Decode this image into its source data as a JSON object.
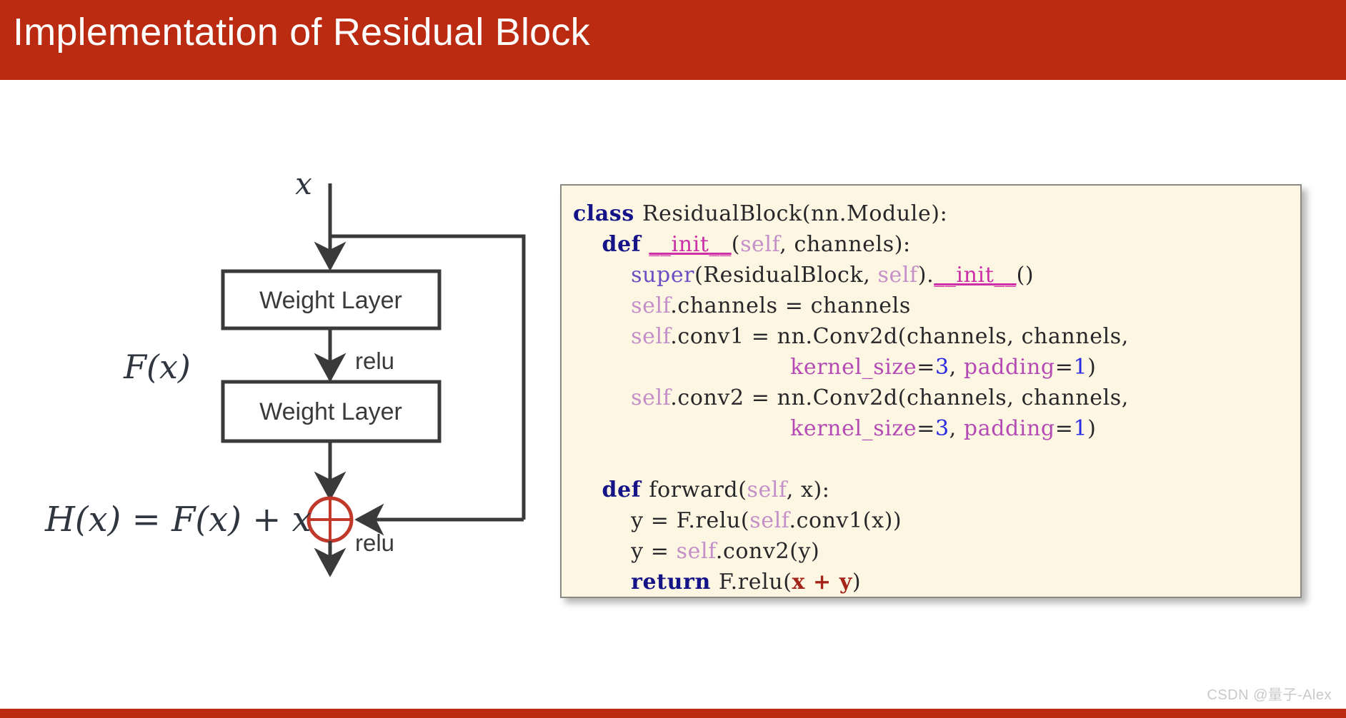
{
  "slide": {
    "title": "Implementation of Residual Block",
    "title_bar_color": "#bb2b11",
    "bottom_bar_color": "#bb2b11",
    "background_color": "#ffffff",
    "watermark": "CSDN @量子-Alex"
  },
  "diagram": {
    "name": "residual-block-diagram",
    "line_color": "#3a3a3a",
    "accent_color": "#c0392b",
    "input_label": "x",
    "residual_label": "F(x)",
    "output_formula": "H(x) = F(x) + x",
    "blocks": [
      {
        "label": "Weight Layer"
      },
      {
        "label": "Weight Layer"
      }
    ],
    "activation_labels": [
      {
        "label": "relu"
      },
      {
        "label": "relu"
      }
    ],
    "add_operator": "plus-circle"
  },
  "code": {
    "language": "python",
    "background_color": "#fdf6e3",
    "border_color": "#8a8a82",
    "lines": [
      {
        "tokens": [
          {
            "t": "class ",
            "c": "k"
          },
          {
            "t": "ResidualBlock(nn.Module):",
            "c": ""
          }
        ]
      },
      {
        "tokens": [
          {
            "t": "    ",
            "c": ""
          },
          {
            "t": "def ",
            "c": "k"
          },
          {
            "t": "__init__",
            "c": "dn"
          },
          {
            "t": "(",
            "c": ""
          },
          {
            "t": "self",
            "c": "sf"
          },
          {
            "t": ", channels):",
            "c": ""
          }
        ]
      },
      {
        "tokens": [
          {
            "t": "        ",
            "c": ""
          },
          {
            "t": "super",
            "c": "su"
          },
          {
            "t": "(ResidualBlock, ",
            "c": ""
          },
          {
            "t": "self",
            "c": "sf"
          },
          {
            "t": ").",
            "c": ""
          },
          {
            "t": "__init__",
            "c": "dn"
          },
          {
            "t": "()",
            "c": ""
          }
        ]
      },
      {
        "tokens": [
          {
            "t": "        ",
            "c": ""
          },
          {
            "t": "self",
            "c": "sf"
          },
          {
            "t": ".channels = channels",
            "c": ""
          }
        ]
      },
      {
        "tokens": [
          {
            "t": "        ",
            "c": ""
          },
          {
            "t": "self",
            "c": "sf"
          },
          {
            "t": ".conv1 = nn.Conv2d(channels, channels,",
            "c": ""
          }
        ]
      },
      {
        "tokens": [
          {
            "t": "                              ",
            "c": ""
          },
          {
            "t": "kernel_size",
            "c": "kw"
          },
          {
            "t": "=",
            "c": ""
          },
          {
            "t": "3",
            "c": "nm"
          },
          {
            "t": ", ",
            "c": ""
          },
          {
            "t": "padding",
            "c": "kw"
          },
          {
            "t": "=",
            "c": ""
          },
          {
            "t": "1",
            "c": "nm"
          },
          {
            "t": ")",
            "c": ""
          }
        ]
      },
      {
        "tokens": [
          {
            "t": "        ",
            "c": ""
          },
          {
            "t": "self",
            "c": "sf"
          },
          {
            "t": ".conv2 = nn.Conv2d(channels, channels,",
            "c": ""
          }
        ]
      },
      {
        "tokens": [
          {
            "t": "                              ",
            "c": ""
          },
          {
            "t": "kernel_size",
            "c": "kw"
          },
          {
            "t": "=",
            "c": ""
          },
          {
            "t": "3",
            "c": "nm"
          },
          {
            "t": ", ",
            "c": ""
          },
          {
            "t": "padding",
            "c": "kw"
          },
          {
            "t": "=",
            "c": ""
          },
          {
            "t": "1",
            "c": "nm"
          },
          {
            "t": ")",
            "c": ""
          }
        ]
      },
      {
        "tokens": [
          {
            "t": " ",
            "c": ""
          }
        ]
      },
      {
        "tokens": [
          {
            "t": "    ",
            "c": ""
          },
          {
            "t": "def ",
            "c": "k"
          },
          {
            "t": "forward(",
            "c": ""
          },
          {
            "t": "self",
            "c": "sf"
          },
          {
            "t": ", x):",
            "c": ""
          }
        ]
      },
      {
        "tokens": [
          {
            "t": "        y = F.relu(",
            "c": ""
          },
          {
            "t": "self",
            "c": "sf"
          },
          {
            "t": ".conv1(x))",
            "c": ""
          }
        ]
      },
      {
        "tokens": [
          {
            "t": "        y = ",
            "c": ""
          },
          {
            "t": "self",
            "c": "sf"
          },
          {
            "t": ".conv2(y)",
            "c": ""
          }
        ]
      },
      {
        "tokens": [
          {
            "t": "        ",
            "c": ""
          },
          {
            "t": "return ",
            "c": "k"
          },
          {
            "t": "F.relu(",
            "c": ""
          },
          {
            "t": "x + y",
            "c": "hi"
          },
          {
            "t": ")",
            "c": ""
          }
        ]
      }
    ]
  }
}
